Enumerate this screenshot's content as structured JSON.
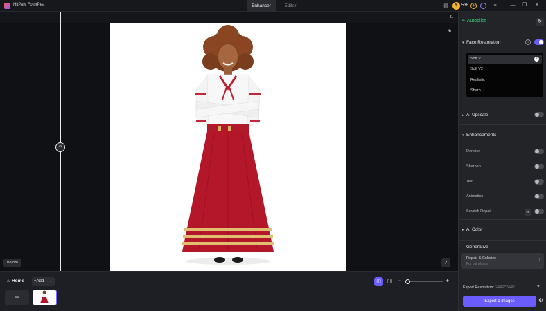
{
  "app": {
    "title": "HitPaw FotorPea"
  },
  "mode_tabs": [
    {
      "label": "Enhancer",
      "active": true
    },
    {
      "label": "Editor",
      "active": false
    }
  ],
  "titlebar": {
    "coins": "538"
  },
  "canvas": {
    "compare_label": "Before"
  },
  "bottom": {
    "home_label": "Home",
    "add_label": "Add",
    "new_tile_label": "+"
  },
  "panel": {
    "autopilot_label": "Autopilot",
    "face_restoration": {
      "title": "Face Restoration",
      "enabled": true,
      "options": [
        {
          "label": "Soft V1",
          "selected": true
        },
        {
          "label": "Soft V2",
          "selected": false
        },
        {
          "label": "Realistic",
          "selected": false
        },
        {
          "label": "Sharp",
          "selected": false
        }
      ]
    },
    "ai_upscale": {
      "title": "AI Upscale",
      "enabled": false
    },
    "enhancements": {
      "title": "Enhancements",
      "items": [
        {
          "label": "Denoise",
          "enabled": false
        },
        {
          "label": "Sharpen",
          "enabled": false
        },
        {
          "label": "Text",
          "enabled": false
        },
        {
          "label": "Animation",
          "enabled": false
        },
        {
          "label": "Scratch Repair",
          "enabled": false
        }
      ]
    },
    "ai_color": {
      "title": "AI Color"
    },
    "generative": {
      "title": "Generative",
      "card_title": "Repair & Colorize",
      "card_subtitle": "For old photos"
    },
    "export": {
      "resolution_label": "Export Resolution:",
      "resolution_value": "244P*244P",
      "button_label": "Export 1 images"
    }
  },
  "colors": {
    "accent": "#6a5cff",
    "autopilot_green": "#36d47c",
    "coin_gold": "#f0b232"
  }
}
